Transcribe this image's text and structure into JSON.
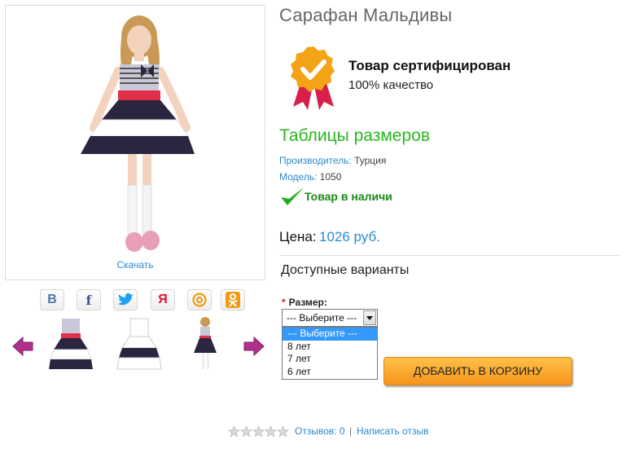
{
  "product": {
    "title": "Сарафан Мальдивы",
    "download_link": "Скачать",
    "certificate": {
      "title": "Товар сертифицирован",
      "subtitle": "100% качество"
    },
    "size_table_link": "Таблицы размеров",
    "manufacturer_label": "Производитель:",
    "manufacturer_value": "Турция",
    "model_label": "Модель:",
    "model_value": "1050",
    "stock_status": "Товар в наличи",
    "price_label": "Цена:",
    "price_value": "1026 руб.",
    "options_heading": "Доступные варианты",
    "size_label": "Размер:",
    "size_required_mark": "*",
    "size_select": {
      "value": "--- Выберите ---",
      "options": [
        "--- Выберите ---",
        "8 лет",
        "7 лет",
        "6 лет"
      ]
    },
    "add_to_cart": "ДОБАВИТЬ В КОРЗИНУ",
    "rating": {
      "stars": 0,
      "max": 5
    },
    "reviews_link": "Отзывов: 0",
    "separator": "|",
    "write_review_link": "Написать отзыв"
  },
  "share": {
    "icons": [
      "vkontakte-icon",
      "facebook-icon",
      "twitter-icon",
      "yandex-icon",
      "mailru-icon",
      "odnoklassniki-icon"
    ],
    "labels": {
      "vk": "В",
      "fb": "f",
      "ya": "Я"
    }
  },
  "colors": {
    "link": "#2a8ad0",
    "green": "#28b81c",
    "button_orange": "#f5951a"
  }
}
